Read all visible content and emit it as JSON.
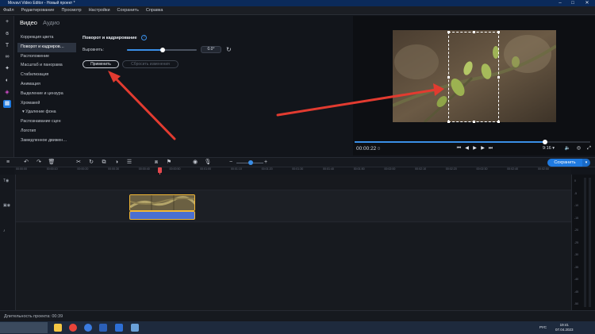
{
  "window": {
    "title": "Movavi Video Editor - Новый проект *",
    "minimize_icon": "minimize-icon",
    "maximize_icon": "maximize-icon",
    "close_icon": "close-icon"
  },
  "menu": [
    "Файл",
    "Редактирование",
    "Просмотр",
    "Настройки",
    "Сохранить",
    "Справка"
  ],
  "tools": [
    "add-icon",
    "effects-icon",
    "text-icon",
    "transitions-icon",
    "stickers-icon",
    "filters-icon",
    "sparkle-icon",
    "more-tools-icon"
  ],
  "tabs": {
    "video": "Видео",
    "audio": "Аудио"
  },
  "effects": [
    "Коррекция цвета",
    "Поворот и кадриров…",
    "Расположение",
    "Масштаб и панорама",
    "Стабилизация",
    "Анимация",
    "Выделение и цензура",
    "Хромакей",
    "▾ Удаление фона",
    "Распознавание сцен",
    "Логотип",
    "Замедленное движен…"
  ],
  "settings": {
    "title": "Поворот и кадрирование",
    "align_label": "Выровнять:",
    "angle_value": "0.0°",
    "angle_fraction": 0.5,
    "apply_label": "Применить",
    "cancel_label": "Сбросить изменения"
  },
  "player": {
    "timecode": "00:00:22",
    "timecode_frames": "0",
    "progress": 0.81,
    "aspect": "9:16 ▾"
  },
  "timeline": {
    "save_label": "Сохранить",
    "ticks": [
      "00:00:00",
      "00:00:10",
      "00:00:20",
      "00:00:30",
      "00:00:40",
      "00:00:50",
      "00:01:00",
      "00:01:10",
      "00:01:20",
      "00:01:30",
      "00:01:40",
      "00:01:50",
      "00:02:00",
      "00:02:10",
      "00:02:20",
      "00:02:30",
      "00:02:40",
      "00:02:50"
    ],
    "meter_labels": [
      "0",
      "-5",
      "-10",
      "-15",
      "-20",
      "-25",
      "-30",
      "-35",
      "-40",
      "-45",
      "-50"
    ]
  },
  "status": {
    "text": "Длительность проекта: 00:39"
  },
  "taskbar": {
    "time": "19:41",
    "date": "07.04.2023",
    "lang": "РУС"
  }
}
